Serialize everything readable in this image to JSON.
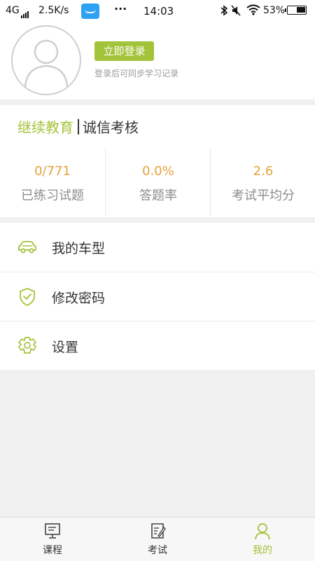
{
  "status_bar": {
    "network": "4G",
    "speed": "2.5K/s",
    "more": "···",
    "time": "14:03",
    "battery": "53%",
    "battery_level": 0.53
  },
  "profile": {
    "login_button": "立即登录",
    "login_hint": "登录后可同步学习记录"
  },
  "category_tabs": {
    "active": "继续教育",
    "inactive": "诚信考核"
  },
  "stats": [
    {
      "value": "0/771",
      "label": "已练习试题"
    },
    {
      "value": "0.0%",
      "label": "答题率"
    },
    {
      "value": "2.6",
      "label": "考试平均分"
    }
  ],
  "menu": {
    "car_model": "我的车型",
    "change_password": "修改密码",
    "settings": "设置"
  },
  "bottom_nav": {
    "courses": "课程",
    "exam": "考试",
    "mine": "我的"
  },
  "colors": {
    "accent": "#a3c33a",
    "stat_value": "#e6a23c",
    "background": "#f0f0f0"
  }
}
